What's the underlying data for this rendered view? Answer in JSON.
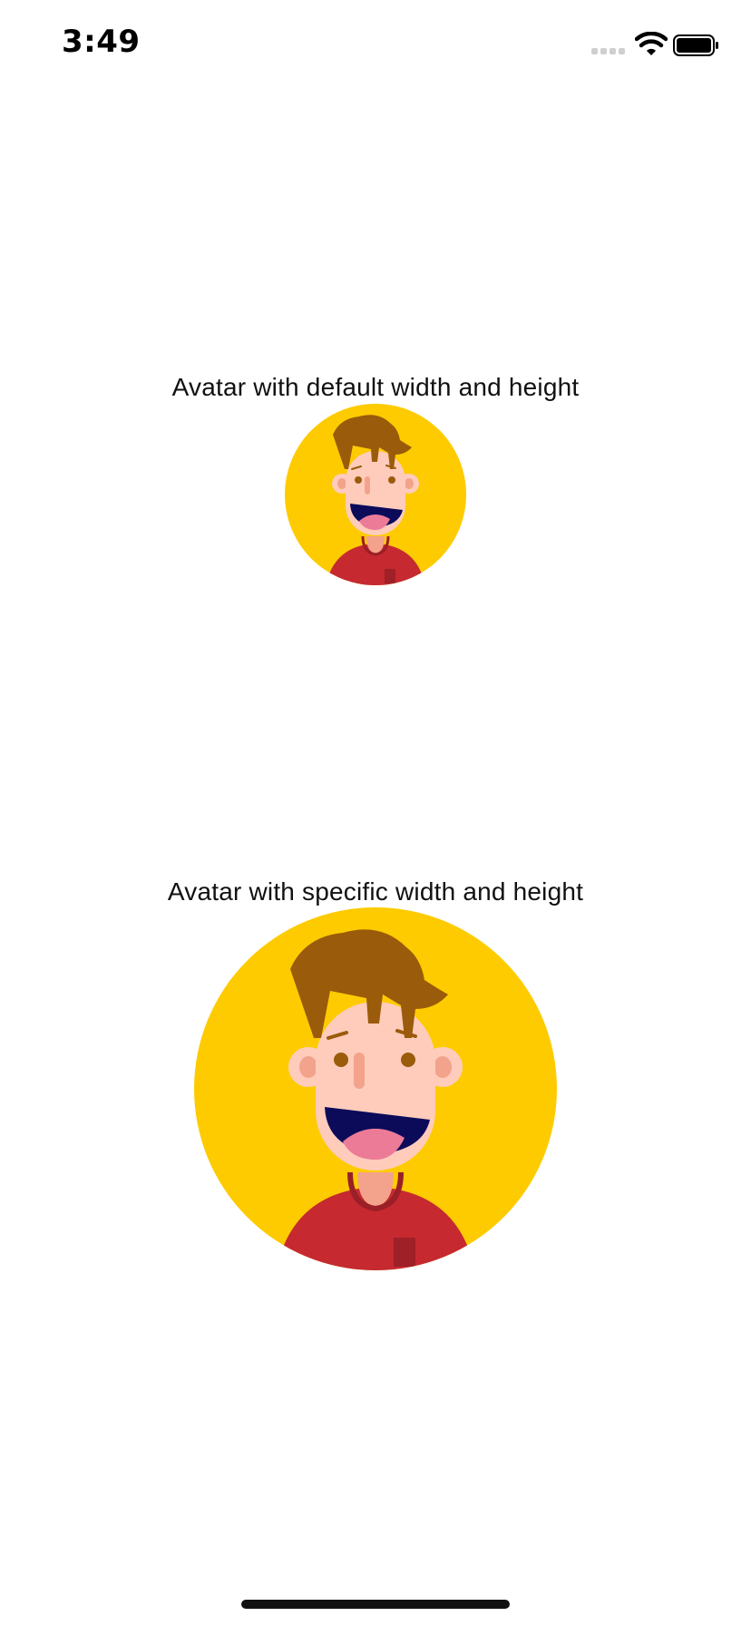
{
  "status_bar": {
    "time": "3:49",
    "signal_icon": "cellular-signal-icon",
    "wifi_icon": "wifi-icon",
    "battery_icon": "battery-icon"
  },
  "sections": [
    {
      "label": "Avatar with default width and height",
      "avatar_icon": "avatar-boy-icon"
    },
    {
      "label": "Avatar with specific width and height",
      "avatar_icon": "avatar-boy-icon"
    }
  ],
  "colors": {
    "avatar_background": "#FDCB00",
    "hair": "#9A5B0B",
    "skin": "#FFCCBC",
    "skin_shadow": "#F3A38B",
    "shirt": "#C62930",
    "mouth": "#0B0B5A",
    "tongue": "#EC7B98"
  }
}
